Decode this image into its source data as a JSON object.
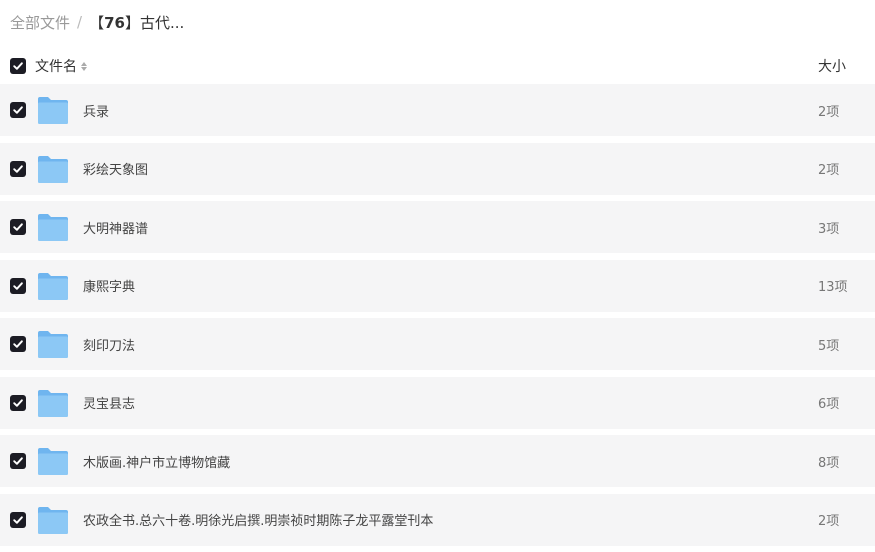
{
  "breadcrumb": {
    "root": "全部文件",
    "separator": "/",
    "current_bracket_open": "【",
    "current_number": "76",
    "current_bracket_close": "】",
    "current_text": "古代..."
  },
  "header": {
    "name_label": "文件名",
    "size_label": "大小",
    "select_all_checked": true
  },
  "colors": {
    "checkbox_fill": "#1c1c24",
    "row_background": "#f5f5f6",
    "folder_back": "#6fb5ef",
    "folder_front": "#8cc8f5"
  },
  "files": [
    {
      "name": "兵录",
      "size": "2项",
      "checked": true,
      "icon": "folder-icon"
    },
    {
      "name": "彩绘天象图",
      "size": "2项",
      "checked": true,
      "icon": "folder-icon"
    },
    {
      "name": "大明神器谱",
      "size": "3项",
      "checked": true,
      "icon": "folder-icon"
    },
    {
      "name": "康熙字典",
      "size": "13项",
      "checked": true,
      "icon": "folder-icon"
    },
    {
      "name": "刻印刀法",
      "size": "5项",
      "checked": true,
      "icon": "folder-icon"
    },
    {
      "name": "灵宝县志",
      "size": "6项",
      "checked": true,
      "icon": "folder-icon"
    },
    {
      "name": "木版画.神户市立博物馆藏",
      "size": "8项",
      "checked": true,
      "icon": "folder-icon"
    },
    {
      "name": "农政全书.总六十卷.明徐光启撰.明崇祯时期陈子龙平露堂刊本",
      "size": "2项",
      "checked": true,
      "icon": "folder-icon"
    }
  ]
}
